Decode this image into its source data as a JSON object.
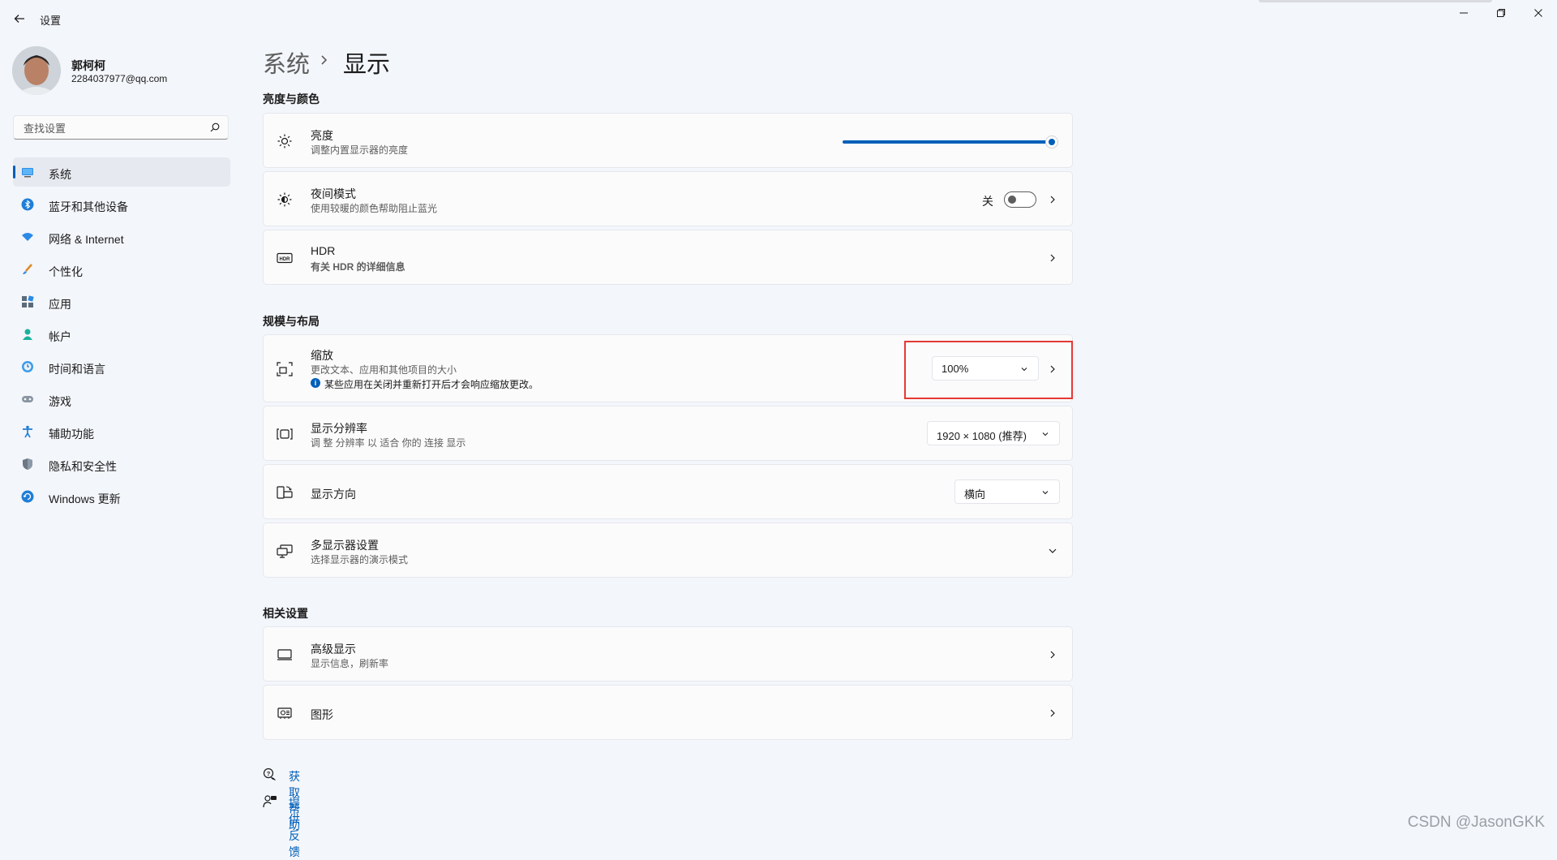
{
  "window": {
    "title": "设置",
    "back_icon": "back-arrow-icon",
    "controls": [
      "minimize-icon",
      "restore-icon",
      "close-icon"
    ]
  },
  "profile": {
    "name": "郭柯柯",
    "email": "2284037977@qq.com"
  },
  "search": {
    "placeholder": "查找设置",
    "value": ""
  },
  "sidebar": {
    "items": [
      {
        "label": "系统",
        "icon": "system-icon",
        "active": true
      },
      {
        "label": "蓝牙和其他设备",
        "icon": "bluetooth-icon"
      },
      {
        "label": "网络 & Internet",
        "icon": "wifi-icon"
      },
      {
        "label": "个性化",
        "icon": "brush-icon"
      },
      {
        "label": "应用",
        "icon": "apps-icon"
      },
      {
        "label": "帐户",
        "icon": "account-icon"
      },
      {
        "label": "时间和语言",
        "icon": "clock-globe-icon"
      },
      {
        "label": "游戏",
        "icon": "gamepad-icon"
      },
      {
        "label": "辅助功能",
        "icon": "accessibility-icon"
      },
      {
        "label": "隐私和安全性",
        "icon": "shield-icon"
      },
      {
        "label": "Windows 更新",
        "icon": "update-icon"
      }
    ]
  },
  "breadcrumb": {
    "parent": "系统",
    "separator": "›",
    "current": "显示"
  },
  "sections": {
    "brightness_color": {
      "title": "亮度与颜色",
      "brightness": {
        "title": "亮度",
        "subtitle": "调整内置显示器的亮度",
        "level_percent": 100
      },
      "night_light": {
        "title": "夜间模式",
        "subtitle": "使用较暖的颜色帮助阻止蓝光",
        "state_label": "关",
        "on": false
      },
      "hdr": {
        "title": "HDR",
        "link": "有关 HDR 的详细信息"
      }
    },
    "scale_layout": {
      "title": "规模与布局",
      "scale": {
        "title": "缩放",
        "subtitle": "更改文本、应用和其他项目的大小",
        "note": "某些应用在关闭并重新打开后才会响应缩放更改。",
        "value": "100%"
      },
      "resolution": {
        "title": "显示分辨率",
        "subtitle": "调 整 分辨率 以 适合 你的 连接 显示",
        "value": "1920 × 1080 (推荐)"
      },
      "orientation": {
        "title": "显示方向",
        "value": "横向"
      },
      "multi_display": {
        "title": "多显示器设置",
        "subtitle": "选择显示器的演示模式"
      }
    },
    "related": {
      "title": "相关设置",
      "advanced": {
        "title": "高级显示",
        "subtitle": "显示信息，刷新率"
      },
      "graphics": {
        "title": "图形"
      }
    }
  },
  "help": {
    "get_help": "获取帮助",
    "feedback": "提供反馈"
  },
  "watermark": "CSDN @JasonGKK",
  "colors": {
    "accent": "#005fb8",
    "highlight_box": "#e53935",
    "background": "#f3f6fb"
  }
}
